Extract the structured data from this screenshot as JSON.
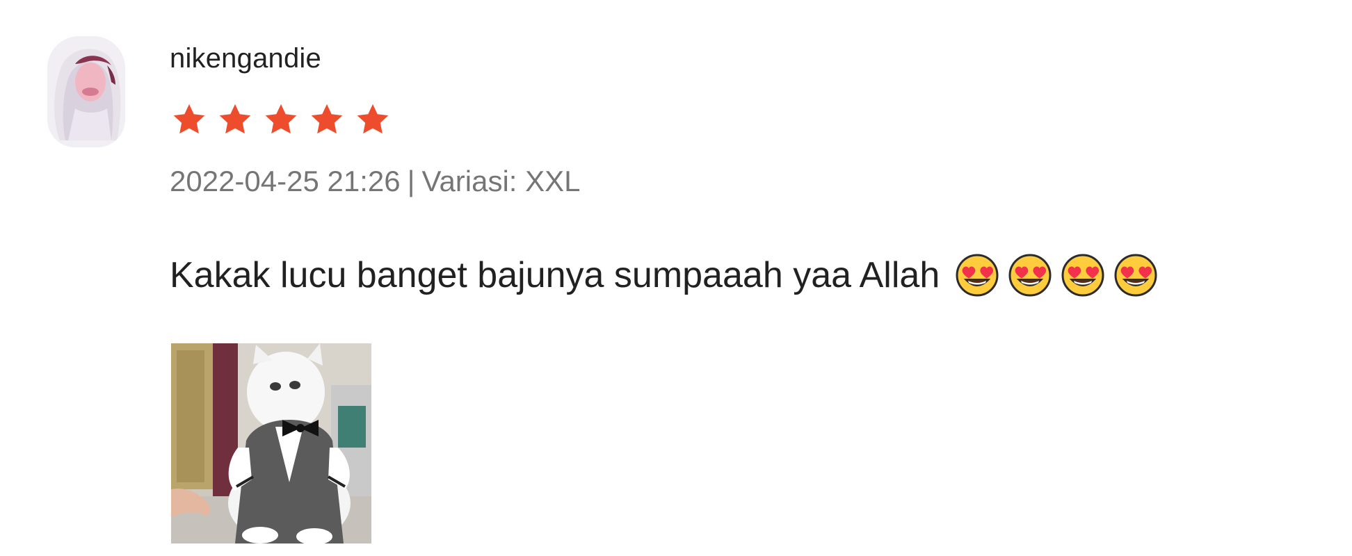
{
  "review": {
    "username": "nikengandie",
    "rating": 5,
    "rating_max": 5,
    "star_color": "#ee4d2d",
    "timestamp": "2022-04-25 21:26",
    "separator": "|",
    "variation": "Variasi: XXL",
    "comment": "Kakak lucu banget bajunya sumpaaah yaa Allah",
    "emojis": [
      "smiling-face-with-heart-eyes-icon",
      "smiling-face-with-heart-eyes-icon",
      "smiling-face-with-heart-eyes-icon",
      "smiling-face-with-heart-eyes-icon"
    ],
    "media": [
      {
        "icon": "photo-cat-in-tuxedo"
      }
    ]
  }
}
